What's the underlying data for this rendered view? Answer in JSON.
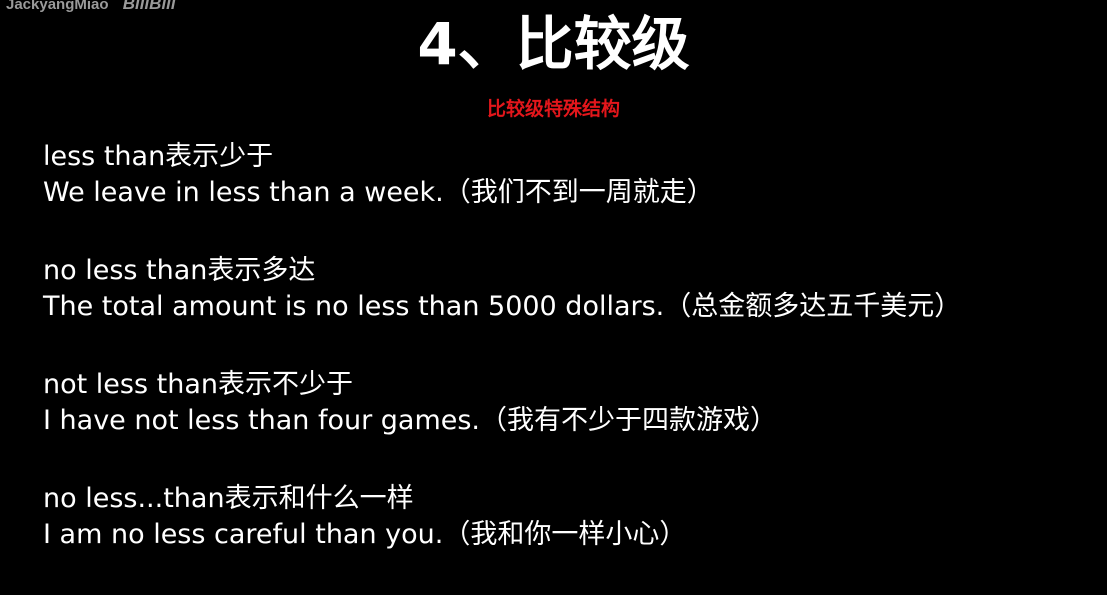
{
  "watermark": {
    "author": "JackyangMiao",
    "brand": "BiliBili"
  },
  "title": "4、比较级",
  "subtitle": "比较级特殊结构",
  "items": [
    {
      "rule": "less than表示少于",
      "example": "We leave in less than a week.（我们不到一周就走）"
    },
    {
      "rule": "no less than表示多达",
      "example": "The total amount is no less than 5000 dollars.（总金额多达五千美元）"
    },
    {
      "rule": "not less than表示不少于",
      "example": "I have not less than four games.（我有不少于四款游戏）"
    },
    {
      "rule": "no less...than表示和什么一样",
      "example": "I am no less careful than you.（我和你一样小心）"
    }
  ]
}
